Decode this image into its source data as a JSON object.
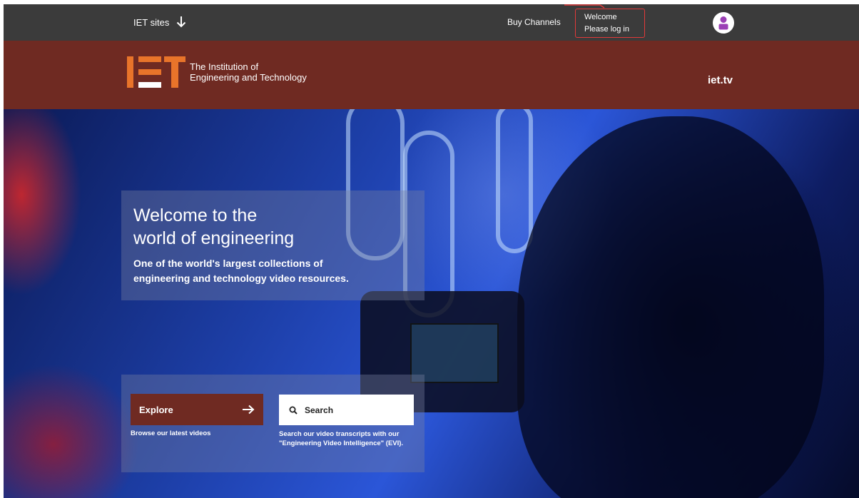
{
  "topbar": {
    "iet_sites_label": "IET sites",
    "buy_channels_label": "Buy Channels",
    "welcome_line1": "Welcome",
    "welcome_line2": "Please log in"
  },
  "header": {
    "logo_line1": "The Institution of",
    "logo_line2": "Engineering and Technology",
    "site_link": "iet.tv"
  },
  "hero": {
    "title_line1": "Welcome to the",
    "title_line2": "world of engineering",
    "subtitle_line1": "One of the world's largest collections of",
    "subtitle_line2": "engineering and technology video resources.",
    "explore_label": "Explore",
    "explore_caption": "Browse our latest videos",
    "search_label": "Search",
    "search_caption_line1": "Search our video transcripts with our",
    "search_caption_line2": "\"Engineering Video Intelligence\" (EVI)."
  },
  "colors": {
    "topbar_bg": "#3b3b3b",
    "brand_maroon": "#6f2a22",
    "logo_orange": "#e8742a",
    "avatar_purple": "#9b3fb5",
    "highlight_red": "#e23a3a"
  },
  "icons": {
    "iet_sites": "arrow-down-icon",
    "user": "user-avatar-icon",
    "explore": "arrow-right-icon",
    "search": "search-icon"
  }
}
